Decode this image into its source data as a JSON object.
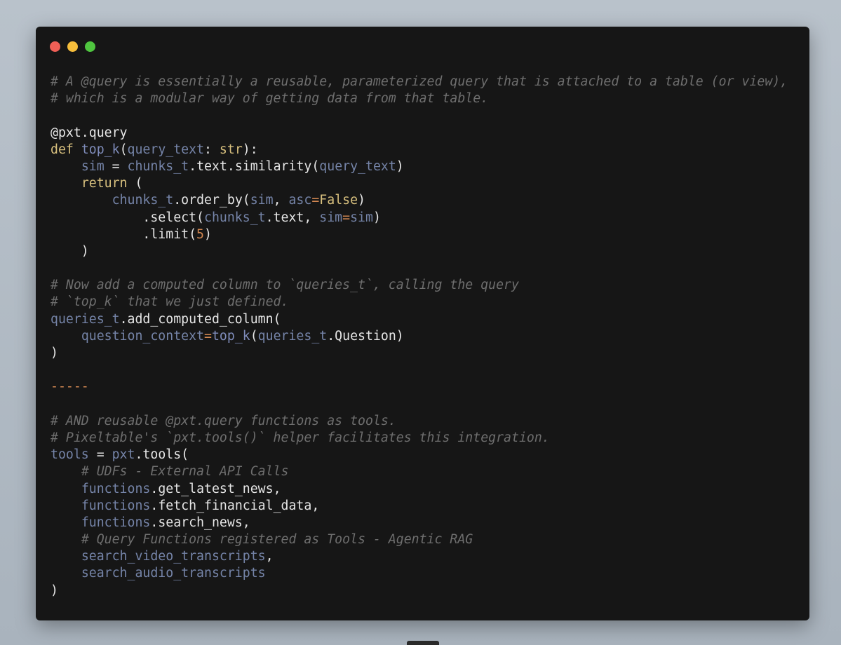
{
  "window": {
    "controls": [
      {
        "name": "close",
        "color": "#ef5f56"
      },
      {
        "name": "minimize",
        "color": "#f6bd3b"
      },
      {
        "name": "maximize",
        "color": "#4fc53f"
      }
    ]
  },
  "code": {
    "lines": [
      [
        {
          "t": "# A @query is essentially a reusable, parameterized query that is attached to a table (or view),",
          "c": "cm"
        }
      ],
      [
        {
          "t": "# which is a modular way of getting data from that table.",
          "c": "cm"
        }
      ],
      [],
      [
        {
          "t": "@pxt.query",
          "c": "dec"
        }
      ],
      [
        {
          "t": "def",
          "c": "kw"
        },
        {
          "t": " ",
          "c": "pl"
        },
        {
          "t": "top_k",
          "c": "fn"
        },
        {
          "t": "(",
          "c": "pl"
        },
        {
          "t": "query_text",
          "c": "var"
        },
        {
          "t": ": ",
          "c": "pl"
        },
        {
          "t": "str",
          "c": "ty"
        },
        {
          "t": "):",
          "c": "pl"
        }
      ],
      [
        {
          "t": "    ",
          "c": "pl"
        },
        {
          "t": "sim",
          "c": "var"
        },
        {
          "t": " = ",
          "c": "pl"
        },
        {
          "t": "chunks_t",
          "c": "var"
        },
        {
          "t": ".text.similarity(",
          "c": "pl"
        },
        {
          "t": "query_text",
          "c": "var"
        },
        {
          "t": ")",
          "c": "pl"
        }
      ],
      [
        {
          "t": "    ",
          "c": "pl"
        },
        {
          "t": "return",
          "c": "kw"
        },
        {
          "t": " (",
          "c": "pl"
        }
      ],
      [
        {
          "t": "        ",
          "c": "pl"
        },
        {
          "t": "chunks_t",
          "c": "var"
        },
        {
          "t": ".order_by(",
          "c": "pl"
        },
        {
          "t": "sim",
          "c": "var"
        },
        {
          "t": ", ",
          "c": "pl"
        },
        {
          "t": "asc",
          "c": "var"
        },
        {
          "t": "=",
          "c": "op"
        },
        {
          "t": "False",
          "c": "kw"
        },
        {
          "t": ")",
          "c": "pl"
        }
      ],
      [
        {
          "t": "            .select(",
          "c": "pl"
        },
        {
          "t": "chunks_t",
          "c": "var"
        },
        {
          "t": ".text, ",
          "c": "pl"
        },
        {
          "t": "sim",
          "c": "var"
        },
        {
          "t": "=",
          "c": "op"
        },
        {
          "t": "sim",
          "c": "var"
        },
        {
          "t": ")",
          "c": "pl"
        }
      ],
      [
        {
          "t": "            .limit(",
          "c": "pl"
        },
        {
          "t": "5",
          "c": "num"
        },
        {
          "t": ")",
          "c": "pl"
        }
      ],
      [
        {
          "t": "    )",
          "c": "pl"
        }
      ],
      [],
      [
        {
          "t": "# Now add a computed column to `queries_t`, calling the query",
          "c": "cm"
        }
      ],
      [
        {
          "t": "# `top_k` that we just defined.",
          "c": "cm"
        }
      ],
      [
        {
          "t": "queries_t",
          "c": "var"
        },
        {
          "t": ".add_computed_column(",
          "c": "pl"
        }
      ],
      [
        {
          "t": "    ",
          "c": "pl"
        },
        {
          "t": "question_context",
          "c": "var"
        },
        {
          "t": "=",
          "c": "op"
        },
        {
          "t": "top_k",
          "c": "fn"
        },
        {
          "t": "(",
          "c": "pl"
        },
        {
          "t": "queries_t",
          "c": "var"
        },
        {
          "t": ".Question)",
          "c": "pl"
        }
      ],
      [
        {
          "t": ")",
          "c": "pl"
        }
      ],
      [],
      [
        {
          "t": "-----",
          "c": "dash"
        }
      ],
      [],
      [
        {
          "t": "# AND reusable @pxt.query functions as tools.",
          "c": "cm"
        }
      ],
      [
        {
          "t": "# Pixeltable's `pxt.tools()` helper facilitates this integration.",
          "c": "cm"
        }
      ],
      [
        {
          "t": "tools",
          "c": "var"
        },
        {
          "t": " = ",
          "c": "pl"
        },
        {
          "t": "pxt",
          "c": "var"
        },
        {
          "t": ".tools(",
          "c": "pl"
        }
      ],
      [
        {
          "t": "    ",
          "c": "pl"
        },
        {
          "t": "# UDFs - External API Calls",
          "c": "cm"
        }
      ],
      [
        {
          "t": "    ",
          "c": "pl"
        },
        {
          "t": "functions",
          "c": "var"
        },
        {
          "t": ".get_latest_news,",
          "c": "pl"
        }
      ],
      [
        {
          "t": "    ",
          "c": "pl"
        },
        {
          "t": "functions",
          "c": "var"
        },
        {
          "t": ".fetch_financial_data,",
          "c": "pl"
        }
      ],
      [
        {
          "t": "    ",
          "c": "pl"
        },
        {
          "t": "functions",
          "c": "var"
        },
        {
          "t": ".search_news,",
          "c": "pl"
        }
      ],
      [
        {
          "t": "    ",
          "c": "pl"
        },
        {
          "t": "# Query Functions registered as Tools - Agentic RAG",
          "c": "cm"
        }
      ],
      [
        {
          "t": "    ",
          "c": "pl"
        },
        {
          "t": "search_video_transcripts",
          "c": "var"
        },
        {
          "t": ",",
          "c": "pl"
        }
      ],
      [
        {
          "t": "    ",
          "c": "pl"
        },
        {
          "t": "search_audio_transcripts",
          "c": "var"
        }
      ],
      [
        {
          "t": ")",
          "c": "pl"
        }
      ]
    ]
  }
}
